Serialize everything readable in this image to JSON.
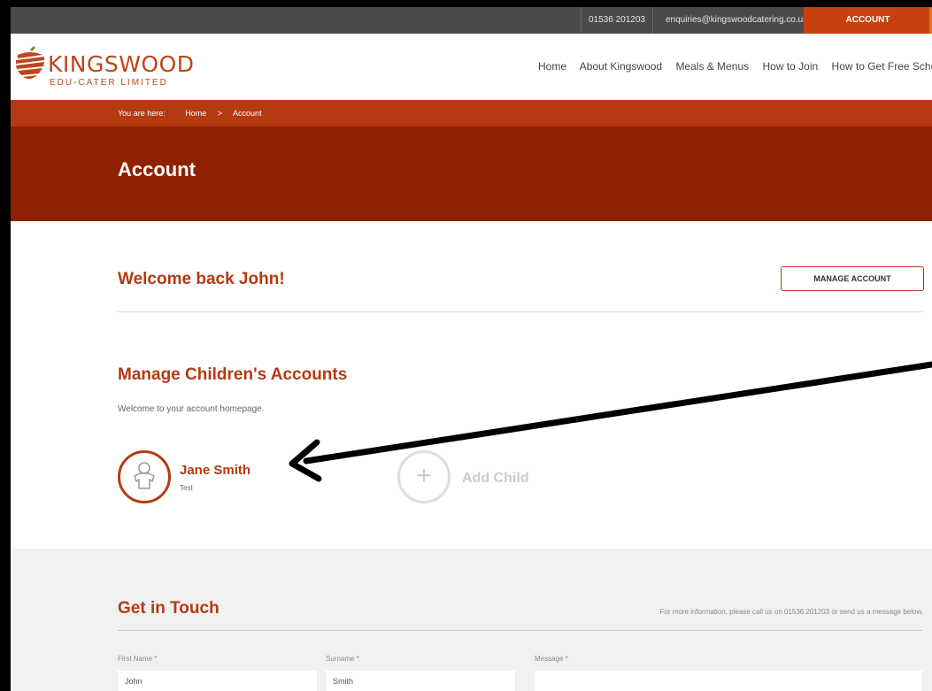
{
  "topbar": {
    "phone": "01536 201203",
    "email": "enquiries@kingswoodcatering.co.uk",
    "account": "ACCOUNT"
  },
  "brand": {
    "name": "KINGSWOOD",
    "subtitle": "EDU-CATER LIMITED",
    "color": "#c0451a"
  },
  "nav": {
    "items": [
      "Home",
      "About Kingswood",
      "Meals & Menus",
      "How to Join",
      "How to Get Free School Me"
    ]
  },
  "breadcrumb": {
    "prefix": "You are here:",
    "home": "Home",
    "separator": ">",
    "current": "Account"
  },
  "hero": {
    "title": "Account"
  },
  "account": {
    "welcome": "Welcome back John!",
    "manage_button": "MANAGE ACCOUNT",
    "children_title": "Manage Children's Accounts",
    "intro": "Welcome to your account homepage.",
    "child": {
      "name": "Jane Smith",
      "subtitle": "Test",
      "icon": "child-avatar-icon"
    },
    "add_child": "Add Child"
  },
  "contact": {
    "title": "Get in Touch",
    "info": "For more information, please call us on 01536 201203 or send us a message below.",
    "first_name_label": "First Name *",
    "first_name_value": "John",
    "surname_label": "Surname *",
    "surname_value": "Smith",
    "message_label": "Message *"
  },
  "colors": {
    "accent": "#b53a12",
    "hero": "#8e2200",
    "topbar": "#4a4a4a"
  }
}
